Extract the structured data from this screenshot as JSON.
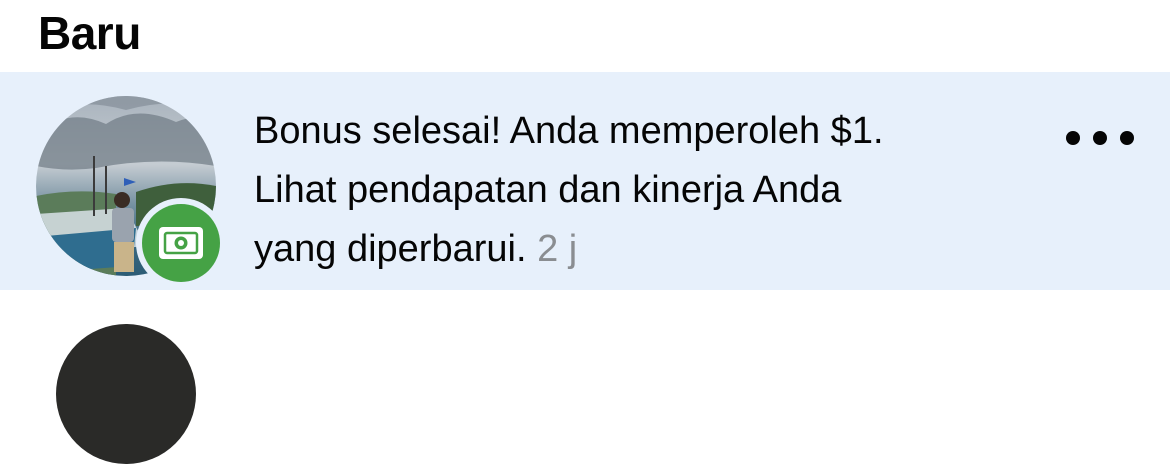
{
  "section": {
    "title": "Baru"
  },
  "notification": {
    "line1": "Bonus selesai! Anda memperoleh $1.",
    "line2": "Lihat pendapatan dan kinerja Anda",
    "line3": "yang diperbarui.",
    "time": "2 j",
    "badge_icon": "money-icon",
    "badge_color": "#45a245",
    "row_background": "#e7f0fb",
    "more_icon": "more-options-icon"
  }
}
